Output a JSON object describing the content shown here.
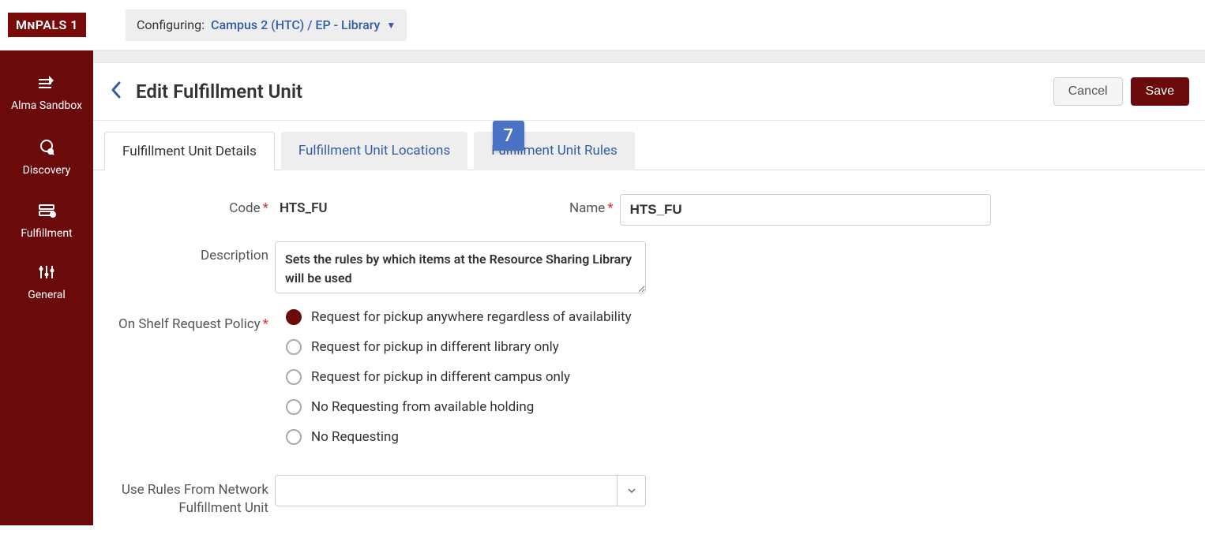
{
  "brand": "MnPALS 1",
  "config_label": "Configuring:",
  "config_value": "Campus 2 (HTC) / EP - Library",
  "sidebar": {
    "items": [
      {
        "label": "Alma Sandbox"
      },
      {
        "label": "Discovery"
      },
      {
        "label": "Fulfillment"
      },
      {
        "label": "General"
      }
    ]
  },
  "page_title": "Edit Fulfillment Unit",
  "buttons": {
    "cancel": "Cancel",
    "save": "Save"
  },
  "tabs": [
    {
      "label": "Fulfillment Unit Details",
      "active": true
    },
    {
      "label": "Fulfillment Unit Locations",
      "active": false
    },
    {
      "label": "Fulfillment Unit Rules",
      "active": false
    }
  ],
  "callout_number": "7",
  "form": {
    "code_label": "Code",
    "code_value": "HTS_FU",
    "name_label": "Name",
    "name_value": "HTS_FU",
    "description_label": "Description",
    "description_value": "Sets the rules by which items at the Resource Sharing Library will be used",
    "shelf_policy_label": "On Shelf Request Policy",
    "shelf_options": [
      "Request for pickup anywhere regardless of availability",
      "Request for pickup in different library only",
      "Request for pickup in different campus only",
      "No Requesting from available holding",
      "No Requesting"
    ],
    "shelf_selected_index": 0,
    "use_rules_label": "Use Rules From Network Fulfillment Unit",
    "use_rules_value": ""
  }
}
